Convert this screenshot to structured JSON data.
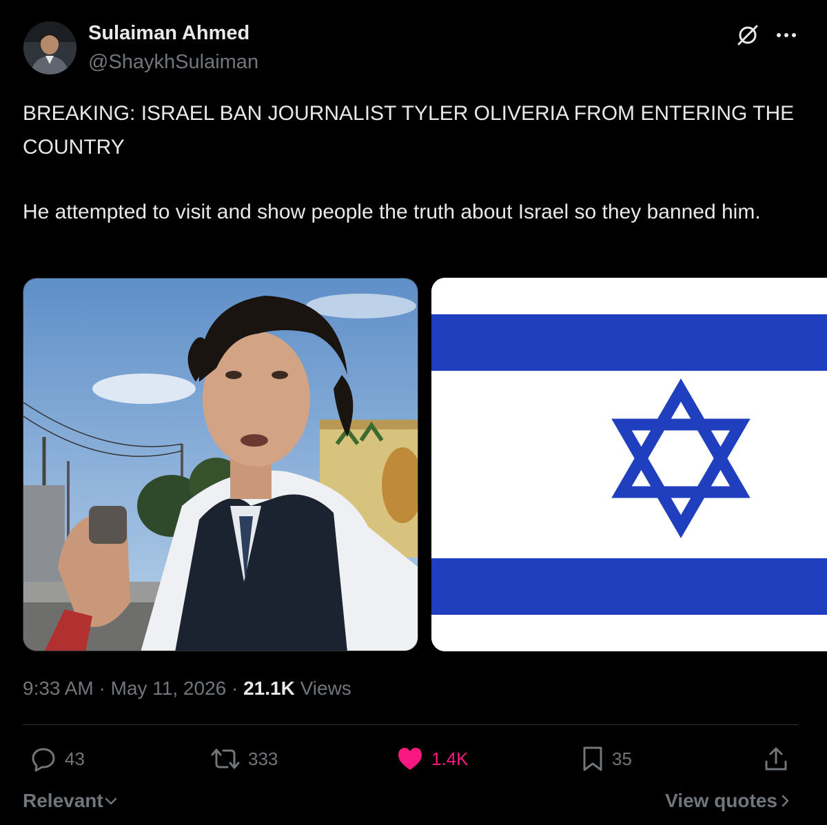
{
  "author": {
    "display_name": "Sulaiman Ahmed",
    "handle": "@ShaykhSulaiman"
  },
  "icons": {
    "grok": "grok-icon",
    "more": "more-icon",
    "reply": "reply-icon",
    "retweet": "retweet-icon",
    "like": "heart-icon",
    "bookmark": "bookmark-icon",
    "share": "share-icon"
  },
  "tweet": {
    "line1": "BREAKING: ISRAEL BAN JOURNALIST TYLER OLIVERIA FROM ENTERING THE COUNTRY",
    "line2": "He attempted to visit and show people the truth about Israel so they banned him."
  },
  "meta": {
    "time": "9:33 AM",
    "sep1": " · ",
    "date": "May 11, 2026",
    "sep2": " · ",
    "views_count": "21.1K",
    "views_label": " Views"
  },
  "actions": {
    "replies": "43",
    "reposts": "333",
    "likes": "1.4K",
    "bookmarks": "35"
  },
  "footer": {
    "sort_label": "Relevant",
    "view_quotes": "View quotes"
  },
  "colors": {
    "background": "#000000",
    "text": "#e7e9ea",
    "muted": "#71767b",
    "like_pink": "#f91880",
    "flag_blue": "#1f3fbf"
  }
}
